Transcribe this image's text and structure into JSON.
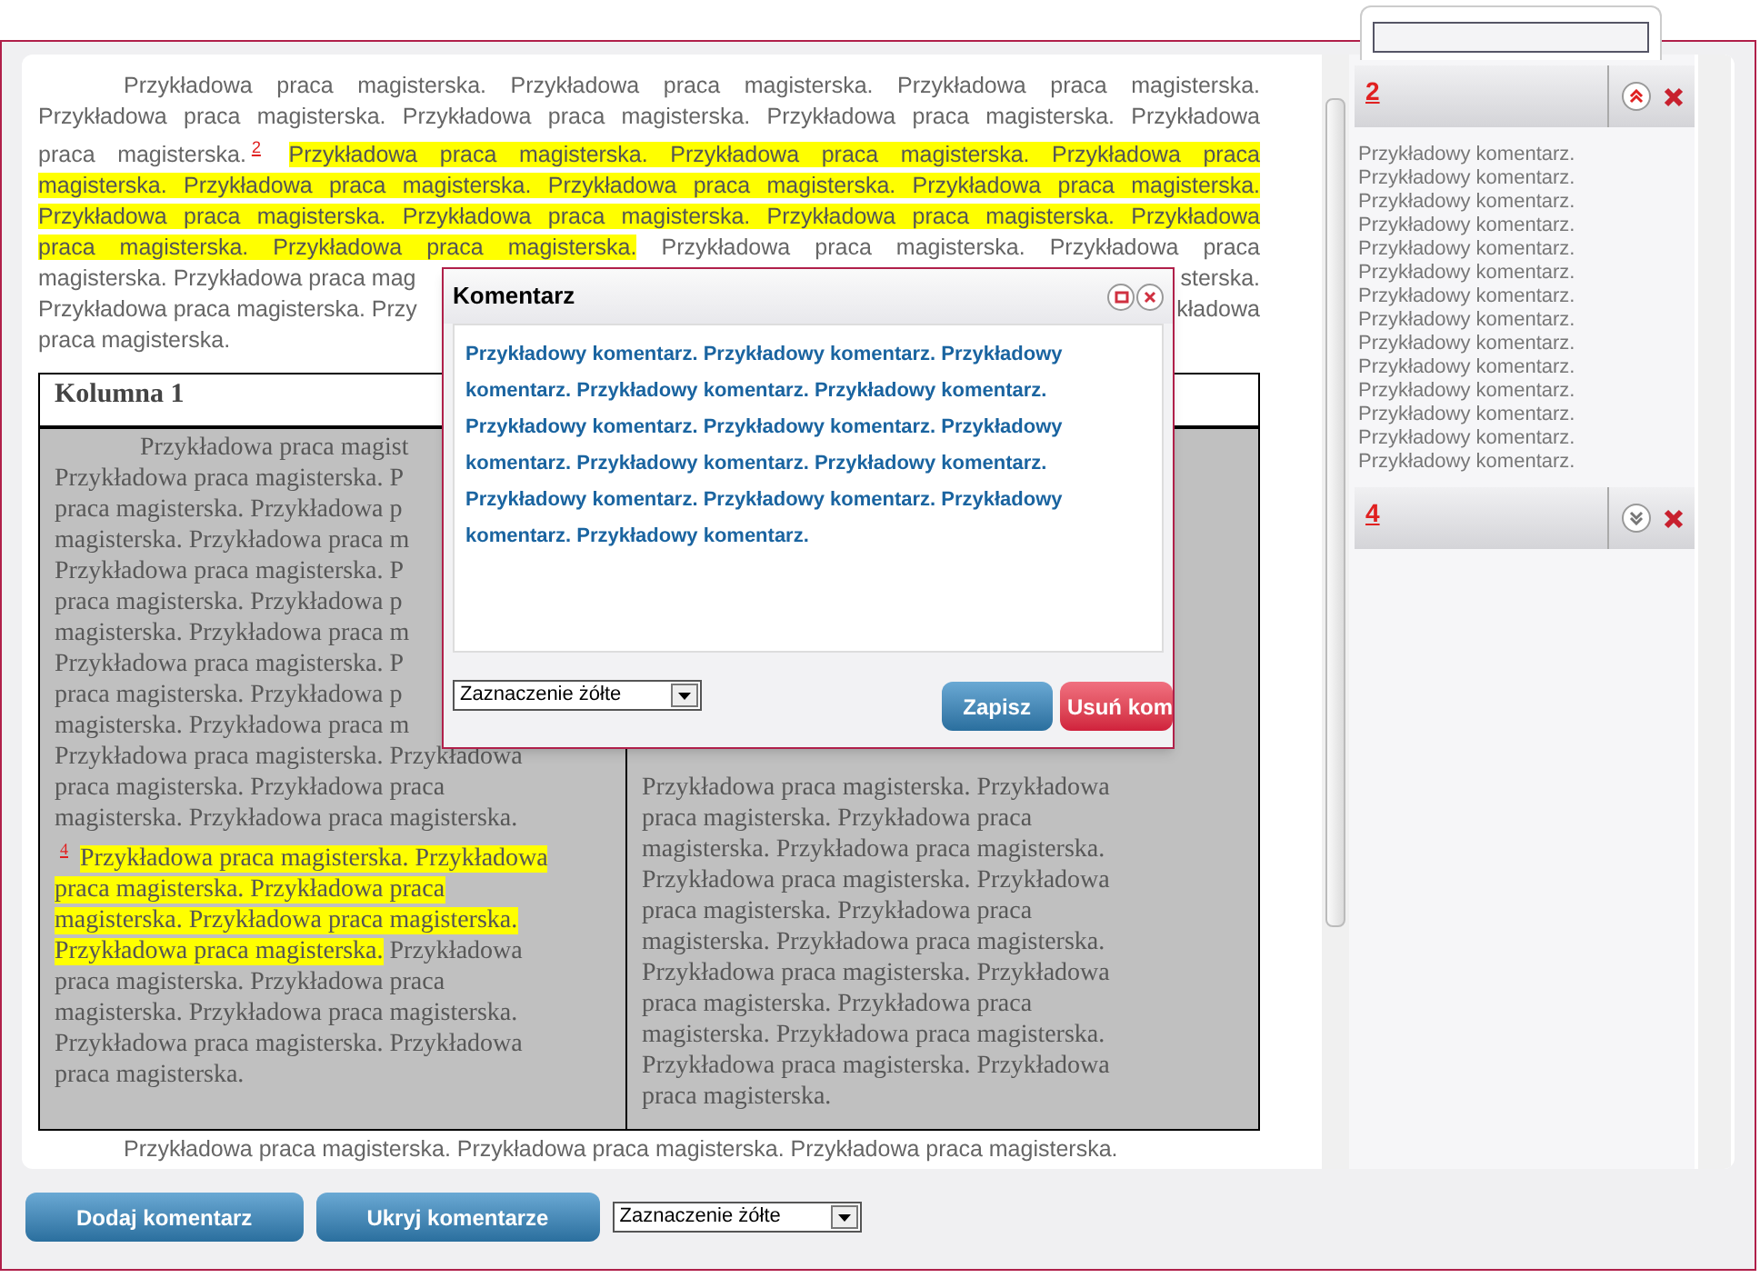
{
  "document": {
    "paragraphs": [
      {
        "lines": [
          {
            "groups": [
              [
                {
                  "kind": "text",
                  "highlighted": false,
                  "text": "Przykładowa praca magisterska. Przykładowa praca magisterska. Przykładowa praca magisterska."
                }
              ]
            ]
          },
          {
            "groups": [
              [
                {
                  "kind": "text",
                  "highlighted": false,
                  "text": "Przykładowa praca magisterska. Przykładowa praca magisterska. Przykładowa praca magisterska. Przykładowa"
                }
              ]
            ]
          },
          {
            "groups": [
              [
                {
                  "kind": "text",
                  "highlighted": false,
                  "text": "praca magisterska."
                },
                {
                  "kind": "footnote",
                  "text": "2"
                },
                {
                  "kind": "text",
                  "highlighted": true,
                  "text": "Przykładowa praca magisterska. Przykładowa praca magisterska. Przykładowa praca"
                }
              ]
            ]
          },
          {
            "groups": [
              [
                {
                  "kind": "text",
                  "highlighted": true,
                  "text": "magisterska. Przykładowa praca magisterska. Przykładowa praca magisterska. Przykładowa praca magisterska."
                }
              ]
            ]
          },
          {
            "groups": [
              [
                {
                  "kind": "text",
                  "highlighted": true,
                  "text": "Przykładowa praca magisterska. Przykładowa praca magisterska. Przykładowa praca magisterska. Przykładowa"
                }
              ]
            ]
          },
          {
            "groups": [
              [
                {
                  "kind": "text",
                  "highlighted": true,
                  "text": "praca magisterska. Przykładowa praca magisterska."
                },
                {
                  "kind": "text",
                  "highlighted": false,
                  "text": "Przykładowa praca magisterska. Przykładowa praca"
                }
              ]
            ]
          },
          {
            "groups": [
              [
                {
                  "kind": "text",
                  "highlighted": false,
                  "text": "magisterska. Przykładowa praca mag"
                }
              ],
              [
                {
                  "kind": "text",
                  "highlighted": false,
                  "text": "sterska."
                }
              ]
            ]
          },
          {
            "groups": [
              [
                {
                  "kind": "text",
                  "highlighted": false,
                  "text": "Przykładowa praca magisterska. Przy"
                }
              ],
              [
                {
                  "kind": "text",
                  "highlighted": false,
                  "text": "kładowa"
                }
              ]
            ]
          },
          {
            "groups": [
              [
                {
                  "kind": "text",
                  "highlighted": false,
                  "text": "praca magisterska."
                }
              ]
            ]
          }
        ]
      }
    ],
    "table": {
      "columns": [
        "Kolumna 1"
      ],
      "cells": [
        {
          "lines": [
            {
              "groups": [
                [
                  {
                    "kind": "text",
                    "highlighted": false,
                    "text": "Przykładowa praca magist"
                  }
                ]
              ]
            },
            {
              "groups": [
                [
                  {
                    "kind": "text",
                    "highlighted": false,
                    "text": "Przykładowa praca magisterska. P"
                  }
                ]
              ]
            },
            {
              "groups": [
                [
                  {
                    "kind": "text",
                    "highlighted": false,
                    "text": "praca magisterska. Przykładowa p"
                  }
                ]
              ]
            },
            {
              "groups": [
                [
                  {
                    "kind": "text",
                    "highlighted": false,
                    "text": "magisterska. Przykładowa praca m"
                  }
                ]
              ]
            },
            {
              "groups": [
                [
                  {
                    "kind": "text",
                    "highlighted": false,
                    "text": "Przykładowa praca magisterska. P"
                  }
                ]
              ]
            },
            {
              "groups": [
                [
                  {
                    "kind": "text",
                    "highlighted": false,
                    "text": "praca magisterska. Przykładowa p"
                  }
                ]
              ]
            },
            {
              "groups": [
                [
                  {
                    "kind": "text",
                    "highlighted": false,
                    "text": "magisterska. Przykładowa praca m"
                  }
                ]
              ]
            },
            {
              "groups": [
                [
                  {
                    "kind": "text",
                    "highlighted": false,
                    "text": "Przykładowa praca magisterska. P"
                  }
                ]
              ]
            },
            {
              "groups": [
                [
                  {
                    "kind": "text",
                    "highlighted": false,
                    "text": "praca magisterska. Przykładowa p"
                  }
                ]
              ]
            },
            {
              "groups": [
                [
                  {
                    "kind": "text",
                    "highlighted": false,
                    "text": "magisterska. Przykładowa praca m"
                  }
                ]
              ]
            },
            {
              "groups": [
                [
                  {
                    "kind": "text",
                    "highlighted": false,
                    "text": "Przykładowa praca magisterska. Przykładowa"
                  }
                ]
              ]
            },
            {
              "groups": [
                [
                  {
                    "kind": "text",
                    "highlighted": false,
                    "text": "praca magisterska. Przykładowa praca"
                  }
                ]
              ]
            },
            {
              "groups": [
                [
                  {
                    "kind": "text",
                    "highlighted": false,
                    "text": "magisterska. Przykładowa praca magisterska."
                  }
                ]
              ]
            },
            {
              "groups": [
                [
                  {
                    "kind": "footnote",
                    "text": "4"
                  },
                  {
                    "kind": "text",
                    "highlighted": true,
                    "text": "Przykładowa praca magisterska. Przykładowa"
                  }
                ]
              ]
            },
            {
              "groups": [
                [
                  {
                    "kind": "text",
                    "highlighted": true,
                    "text": "praca magisterska. Przykładowa praca"
                  }
                ]
              ]
            },
            {
              "groups": [
                [
                  {
                    "kind": "text",
                    "highlighted": true,
                    "text": "magisterska. Przykładowa praca magisterska."
                  }
                ]
              ]
            },
            {
              "groups": [
                [
                  {
                    "kind": "text",
                    "highlighted": true,
                    "text": "Przykładowa praca magisterska."
                  },
                  {
                    "kind": "text",
                    "highlighted": false,
                    "text": "Przykładowa"
                  }
                ]
              ]
            },
            {
              "groups": [
                [
                  {
                    "kind": "text",
                    "highlighted": false,
                    "text": "praca magisterska. Przykładowa praca"
                  }
                ]
              ]
            },
            {
              "groups": [
                [
                  {
                    "kind": "text",
                    "highlighted": false,
                    "text": "magisterska. Przykładowa praca magisterska."
                  }
                ]
              ]
            },
            {
              "groups": [
                [
                  {
                    "kind": "text",
                    "highlighted": false,
                    "text": "Przykładowa praca magisterska. Przykładowa"
                  }
                ]
              ]
            },
            {
              "groups": [
                [
                  {
                    "kind": "text",
                    "highlighted": false,
                    "text": "praca magisterska."
                  }
                ]
              ]
            }
          ]
        },
        {
          "lines": [
            {
              "groups": [
                [
                  {
                    "kind": "text",
                    "highlighted": false,
                    "text": "Przykładowa praca magisterska. Przykładowa"
                  }
                ]
              ]
            },
            {
              "groups": [
                [
                  {
                    "kind": "text",
                    "highlighted": false,
                    "text": "praca magisterska. Przykładowa praca"
                  }
                ]
              ]
            },
            {
              "groups": [
                [
                  {
                    "kind": "text",
                    "highlighted": false,
                    "text": "magisterska. Przykładowa praca magisterska."
                  }
                ]
              ]
            },
            {
              "groups": [
                [
                  {
                    "kind": "text",
                    "highlighted": false,
                    "text": "Przykładowa praca magisterska. Przykładowa"
                  }
                ]
              ]
            },
            {
              "groups": [
                [
                  {
                    "kind": "text",
                    "highlighted": false,
                    "text": "praca magisterska. Przykładowa praca"
                  }
                ]
              ]
            },
            {
              "groups": [
                [
                  {
                    "kind": "text",
                    "highlighted": false,
                    "text": "magisterska. Przykładowa praca magisterska."
                  }
                ]
              ]
            },
            {
              "groups": [
                [
                  {
                    "kind": "text",
                    "highlighted": false,
                    "text": "Przykładowa praca magisterska. Przykładowa"
                  }
                ]
              ]
            },
            {
              "groups": [
                [
                  {
                    "kind": "text",
                    "highlighted": false,
                    "text": "praca magisterska. Przykładowa praca"
                  }
                ]
              ]
            },
            {
              "groups": [
                [
                  {
                    "kind": "text",
                    "highlighted": false,
                    "text": "magisterska. Przykładowa praca magisterska."
                  }
                ]
              ]
            },
            {
              "groups": [
                [
                  {
                    "kind": "text",
                    "highlighted": false,
                    "text": "Przykładowa praca magisterska. Przykładowa"
                  }
                ]
              ]
            },
            {
              "groups": [
                [
                  {
                    "kind": "text",
                    "highlighted": false,
                    "text": "praca magisterska."
                  }
                ]
              ]
            }
          ]
        }
      ]
    },
    "outro": {
      "lines": [
        {
          "groups": [
            [
              {
                "kind": "text",
                "highlighted": false,
                "text": "Przykładowa praca magisterska. Przykładowa praca magisterska. Przykładowa praca magisterska."
              }
            ]
          ]
        }
      ]
    }
  },
  "comments": [
    {
      "number": "2",
      "expanded": true,
      "lines": [
        "Przykładowy komentarz.",
        "Przykładowy komentarz.",
        "Przykładowy komentarz.",
        "Przykładowy komentarz.",
        "Przykładowy komentarz.",
        "Przykładowy komentarz.",
        "Przykładowy komentarz.",
        "Przykładowy komentarz.",
        "Przykładowy komentarz.",
        "Przykładowy komentarz.",
        "Przykładowy komentarz.",
        "Przykładowy komentarz.",
        "Przykładowy komentarz.",
        "Przykładowy komentarz."
      ]
    },
    {
      "number": "4",
      "expanded": false
    }
  ],
  "dialog": {
    "title": "Komentarz",
    "text": "Przykładowy komentarz. Przykładowy komentarz. Przykładowy komentarz. Przykładowy komentarz. Przykładowy komentarz. Przykładowy komentarz. Przykładowy komentarz. Przykładowy komentarz. Przykładowy komentarz. Przykładowy komentarz. Przykładowy komentarz. Przykładowy komentarz. Przykładowy komentarz. Przykładowy komentarz.",
    "select": "Zaznaczenie żółte",
    "buttons": [
      {
        "kind": "save",
        "label": "Zapisz"
      },
      {
        "kind": "delete",
        "label": "Usuń kom"
      }
    ]
  },
  "toolbar": {
    "buttons": [
      "Dodaj komentarz",
      "Ukryj komentarze"
    ],
    "select": "Zaznaczenie żółte"
  }
}
